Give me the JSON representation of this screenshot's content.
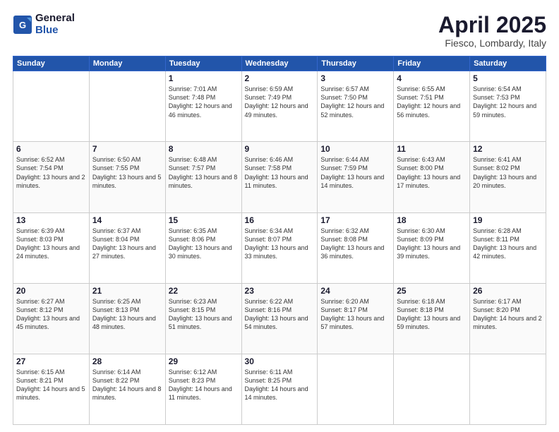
{
  "header": {
    "logo_general": "General",
    "logo_blue": "Blue",
    "title": "April 2025",
    "location": "Fiesco, Lombardy, Italy"
  },
  "weekdays": [
    "Sunday",
    "Monday",
    "Tuesday",
    "Wednesday",
    "Thursday",
    "Friday",
    "Saturday"
  ],
  "weeks": [
    [
      null,
      null,
      {
        "day": "1",
        "sunrise": "Sunrise: 7:01 AM",
        "sunset": "Sunset: 7:48 PM",
        "daylight": "Daylight: 12 hours and 46 minutes."
      },
      {
        "day": "2",
        "sunrise": "Sunrise: 6:59 AM",
        "sunset": "Sunset: 7:49 PM",
        "daylight": "Daylight: 12 hours and 49 minutes."
      },
      {
        "day": "3",
        "sunrise": "Sunrise: 6:57 AM",
        "sunset": "Sunset: 7:50 PM",
        "daylight": "Daylight: 12 hours and 52 minutes."
      },
      {
        "day": "4",
        "sunrise": "Sunrise: 6:55 AM",
        "sunset": "Sunset: 7:51 PM",
        "daylight": "Daylight: 12 hours and 56 minutes."
      },
      {
        "day": "5",
        "sunrise": "Sunrise: 6:54 AM",
        "sunset": "Sunset: 7:53 PM",
        "daylight": "Daylight: 12 hours and 59 minutes."
      }
    ],
    [
      {
        "day": "6",
        "sunrise": "Sunrise: 6:52 AM",
        "sunset": "Sunset: 7:54 PM",
        "daylight": "Daylight: 13 hours and 2 minutes."
      },
      {
        "day": "7",
        "sunrise": "Sunrise: 6:50 AM",
        "sunset": "Sunset: 7:55 PM",
        "daylight": "Daylight: 13 hours and 5 minutes."
      },
      {
        "day": "8",
        "sunrise": "Sunrise: 6:48 AM",
        "sunset": "Sunset: 7:57 PM",
        "daylight": "Daylight: 13 hours and 8 minutes."
      },
      {
        "day": "9",
        "sunrise": "Sunrise: 6:46 AM",
        "sunset": "Sunset: 7:58 PM",
        "daylight": "Daylight: 13 hours and 11 minutes."
      },
      {
        "day": "10",
        "sunrise": "Sunrise: 6:44 AM",
        "sunset": "Sunset: 7:59 PM",
        "daylight": "Daylight: 13 hours and 14 minutes."
      },
      {
        "day": "11",
        "sunrise": "Sunrise: 6:43 AM",
        "sunset": "Sunset: 8:00 PM",
        "daylight": "Daylight: 13 hours and 17 minutes."
      },
      {
        "day": "12",
        "sunrise": "Sunrise: 6:41 AM",
        "sunset": "Sunset: 8:02 PM",
        "daylight": "Daylight: 13 hours and 20 minutes."
      }
    ],
    [
      {
        "day": "13",
        "sunrise": "Sunrise: 6:39 AM",
        "sunset": "Sunset: 8:03 PM",
        "daylight": "Daylight: 13 hours and 24 minutes."
      },
      {
        "day": "14",
        "sunrise": "Sunrise: 6:37 AM",
        "sunset": "Sunset: 8:04 PM",
        "daylight": "Daylight: 13 hours and 27 minutes."
      },
      {
        "day": "15",
        "sunrise": "Sunrise: 6:35 AM",
        "sunset": "Sunset: 8:06 PM",
        "daylight": "Daylight: 13 hours and 30 minutes."
      },
      {
        "day": "16",
        "sunrise": "Sunrise: 6:34 AM",
        "sunset": "Sunset: 8:07 PM",
        "daylight": "Daylight: 13 hours and 33 minutes."
      },
      {
        "day": "17",
        "sunrise": "Sunrise: 6:32 AM",
        "sunset": "Sunset: 8:08 PM",
        "daylight": "Daylight: 13 hours and 36 minutes."
      },
      {
        "day": "18",
        "sunrise": "Sunrise: 6:30 AM",
        "sunset": "Sunset: 8:09 PM",
        "daylight": "Daylight: 13 hours and 39 minutes."
      },
      {
        "day": "19",
        "sunrise": "Sunrise: 6:28 AM",
        "sunset": "Sunset: 8:11 PM",
        "daylight": "Daylight: 13 hours and 42 minutes."
      }
    ],
    [
      {
        "day": "20",
        "sunrise": "Sunrise: 6:27 AM",
        "sunset": "Sunset: 8:12 PM",
        "daylight": "Daylight: 13 hours and 45 minutes."
      },
      {
        "day": "21",
        "sunrise": "Sunrise: 6:25 AM",
        "sunset": "Sunset: 8:13 PM",
        "daylight": "Daylight: 13 hours and 48 minutes."
      },
      {
        "day": "22",
        "sunrise": "Sunrise: 6:23 AM",
        "sunset": "Sunset: 8:15 PM",
        "daylight": "Daylight: 13 hours and 51 minutes."
      },
      {
        "day": "23",
        "sunrise": "Sunrise: 6:22 AM",
        "sunset": "Sunset: 8:16 PM",
        "daylight": "Daylight: 13 hours and 54 minutes."
      },
      {
        "day": "24",
        "sunrise": "Sunrise: 6:20 AM",
        "sunset": "Sunset: 8:17 PM",
        "daylight": "Daylight: 13 hours and 57 minutes."
      },
      {
        "day": "25",
        "sunrise": "Sunrise: 6:18 AM",
        "sunset": "Sunset: 8:18 PM",
        "daylight": "Daylight: 13 hours and 59 minutes."
      },
      {
        "day": "26",
        "sunrise": "Sunrise: 6:17 AM",
        "sunset": "Sunset: 8:20 PM",
        "daylight": "Daylight: 14 hours and 2 minutes."
      }
    ],
    [
      {
        "day": "27",
        "sunrise": "Sunrise: 6:15 AM",
        "sunset": "Sunset: 8:21 PM",
        "daylight": "Daylight: 14 hours and 5 minutes."
      },
      {
        "day": "28",
        "sunrise": "Sunrise: 6:14 AM",
        "sunset": "Sunset: 8:22 PM",
        "daylight": "Daylight: 14 hours and 8 minutes."
      },
      {
        "day": "29",
        "sunrise": "Sunrise: 6:12 AM",
        "sunset": "Sunset: 8:23 PM",
        "daylight": "Daylight: 14 hours and 11 minutes."
      },
      {
        "day": "30",
        "sunrise": "Sunrise: 6:11 AM",
        "sunset": "Sunset: 8:25 PM",
        "daylight": "Daylight: 14 hours and 14 minutes."
      },
      null,
      null,
      null
    ]
  ]
}
